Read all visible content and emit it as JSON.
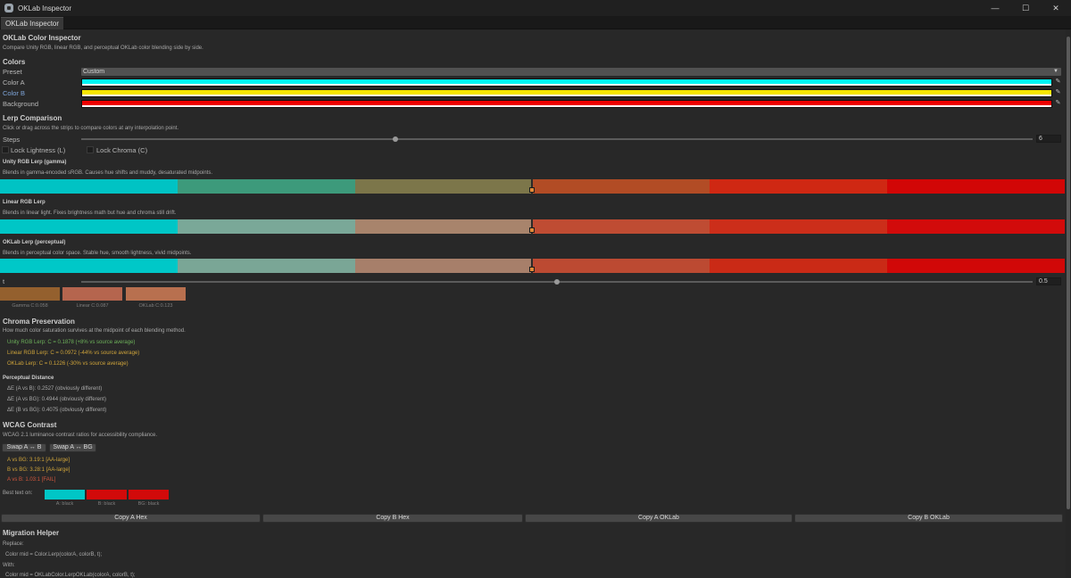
{
  "window": {
    "title": "OKLab Inspector",
    "tab": "OKLab Inspector",
    "minimize": "—",
    "maximize": "☐",
    "close": "✕"
  },
  "header": {
    "title": "OKLab Color Inspector",
    "subtitle": "Compare Unity RGB, linear RGB, and perceptual OKLab color blending side by side."
  },
  "colors": {
    "section": "Colors",
    "preset_label": "Preset",
    "preset_value": "Custom",
    "color_a_label": "Color A",
    "color_a": "#00f5f5",
    "color_b_label": "Color B",
    "color_b": "#f5e600",
    "background_label": "Background",
    "background": "#ee0000"
  },
  "lerp": {
    "section": "Lerp Comparison",
    "hint": "Click or drag across the strips to compare colors at any interpolation point.",
    "steps_label": "Steps",
    "steps_value": "6",
    "steps_fraction": 0.33,
    "lock_lightness": "Lock Lightness (L)",
    "lock_chroma": "Lock Chroma (C)",
    "t_label": "t",
    "t_value": "0.5",
    "t_fraction": 0.5,
    "strips": [
      {
        "title": "Unity RGB Lerp (gamma)",
        "desc": "Blends in gamma-encoded sRGB. Causes hue shifts and muddy, desaturated midpoints.",
        "colors": [
          "#00c3c4",
          "#3d9a7b",
          "#7c764a",
          "#b24c25",
          "#cf2813",
          "#d20606"
        ]
      },
      {
        "title": "Linear RGB Lerp",
        "desc": "Blends in linear light. Fixes brightness math but hue and chroma still drift.",
        "colors": [
          "#00c6c6",
          "#7aa898",
          "#a8846c",
          "#bf4c33",
          "#cc2e1a",
          "#d20b0b"
        ]
      },
      {
        "title": "OKLab Lerp (perceptual)",
        "desc": "Blends in perceptual color space. Stable hue, smooth lightness, vivid midpoints.",
        "colors": [
          "#00c8c8",
          "#7aa696",
          "#a77f6a",
          "#bc4a32",
          "#ca2a16",
          "#d10808"
        ]
      }
    ],
    "results": [
      {
        "label": "Gamma C:0.058",
        "color": "#94602e"
      },
      {
        "label": "Linear C:0.087",
        "color": "#b5654e"
      },
      {
        "label": "OKLab C:0.123",
        "color": "#b8704f"
      }
    ]
  },
  "chroma": {
    "section": "Chroma Preservation",
    "desc": "How much color saturation survives at the midpoint of each blending method.",
    "lines": [
      {
        "text": "Unity RGB Lerp: C = 0.1878   (+8% vs source average)",
        "color": "#6db25a"
      },
      {
        "text": "Linear RGB Lerp: C = 0.0972   (-44% vs source average)",
        "color": "#cfa43a"
      },
      {
        "text": "OKLab Lerp: C = 0.1226   (-30% vs source average)",
        "color": "#cfa43a"
      }
    ]
  },
  "distance": {
    "section": "Perceptual Distance",
    "lines": [
      "ΔE (A vs B):  0.2527  (obviously different)",
      "ΔE (A vs BG): 0.4944  (obviously different)",
      "ΔE (B vs BG): 0.4075  (obviously different)"
    ]
  },
  "wcag": {
    "section": "WCAG Contrast",
    "desc": "WCAG 2.1 luminance contrast ratios for accessibility compliance.",
    "swap_ab": "Swap A ↔ B",
    "swap_abg": "Swap A ↔ BG",
    "lines": [
      {
        "text": "A vs BG: 3.19:1  [AA-large]",
        "color": "#cfa43a"
      },
      {
        "text": "B vs BG: 3.28:1  [AA-large]",
        "color": "#cfa43a"
      },
      {
        "text": "A vs B: 1.03:1  [FAIL]",
        "color": "#d0563c"
      }
    ],
    "best_text_label": "Best text on:",
    "best": [
      {
        "label": "A: black",
        "color": "#00c6c6"
      },
      {
        "label": "B: black",
        "color": "#d20a0a"
      },
      {
        "label": "BG: black",
        "color": "#d20a0a"
      }
    ]
  },
  "copy_buttons": [
    "Copy A Hex",
    "Copy B Hex",
    "Copy A OKLab",
    "Copy B OKLab"
  ],
  "migration": {
    "section": "Migration Helper",
    "replace_label": "Replace:",
    "replace_code": "Color mid = Color.Lerp(colorA, colorB, t);",
    "with_label": "With:",
    "with_code": "Color mid = OKLabColor.LerpOKLab(colorA, colorB, t);"
  }
}
